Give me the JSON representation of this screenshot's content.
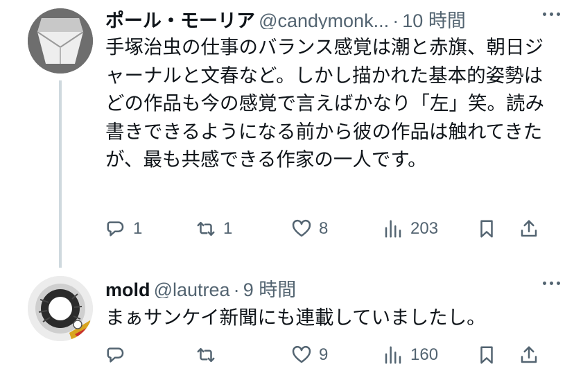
{
  "post1": {
    "author": {
      "name": "ポール・モーリア",
      "handle": "@candymonk...",
      "time": "10 時間"
    },
    "text": "手塚治虫の仕事のバランス感覚は潮と赤旗、朝日ジャーナルと文春など。しかし描かれた基本的姿勢はどの作品も今の感覚で言えばかなり「左」笑。読み書きできるようになる前から彼の作品は触れてきたが、最も共感できる作家の一人です。",
    "stats": {
      "replies": "1",
      "reposts": "1",
      "likes": "8",
      "views": "203"
    }
  },
  "post2": {
    "author": {
      "name": "mold",
      "handle": "@lautrea",
      "time": "9 時間"
    },
    "text": "まぁサンケイ新聞にも連載していましたし。",
    "stats": {
      "replies": "",
      "reposts": "",
      "likes": "9",
      "views": "160"
    }
  },
  "separator": "·",
  "icons": {
    "reply": "speech-bubble",
    "repost": "circular-arrows",
    "like": "heart-outline",
    "views": "bar-chart",
    "bookmark": "bookmark-outline",
    "share": "upload-arrow",
    "more": "three-dots"
  },
  "colors": {
    "text": "#0f1419",
    "secondary": "#536471",
    "thread_line": "#cfd9de"
  }
}
